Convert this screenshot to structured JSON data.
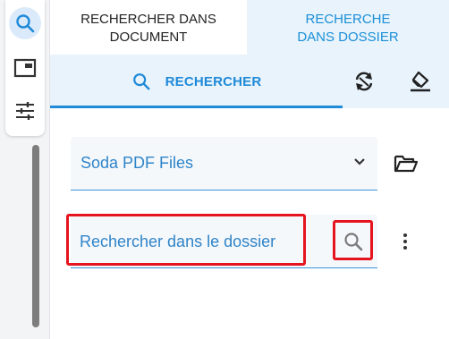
{
  "tabs": [
    {
      "label": "RECHERCHER DANS DOCUMENT",
      "active": false
    },
    {
      "label": "RECHERCHE DANS DOSSIER",
      "active": true
    }
  ],
  "action_bar": {
    "search_label": "RECHERCHER",
    "icons": [
      "search-icon",
      "refresh-icon",
      "eraser-icon"
    ]
  },
  "left_rail": {
    "icons": [
      "search-icon",
      "panel-icon",
      "sliders-icon"
    ],
    "active": "search-icon"
  },
  "folder_select": {
    "value": "Soda PDF Files",
    "icons": [
      "chevron-down-icon",
      "folder-open-icon"
    ]
  },
  "search": {
    "placeholder": "Rechercher dans le dossier",
    "value": ""
  },
  "colors": {
    "accent": "#1f8ad8",
    "highlight": "#e5141f",
    "panel_tint": "#e8f3fc"
  }
}
